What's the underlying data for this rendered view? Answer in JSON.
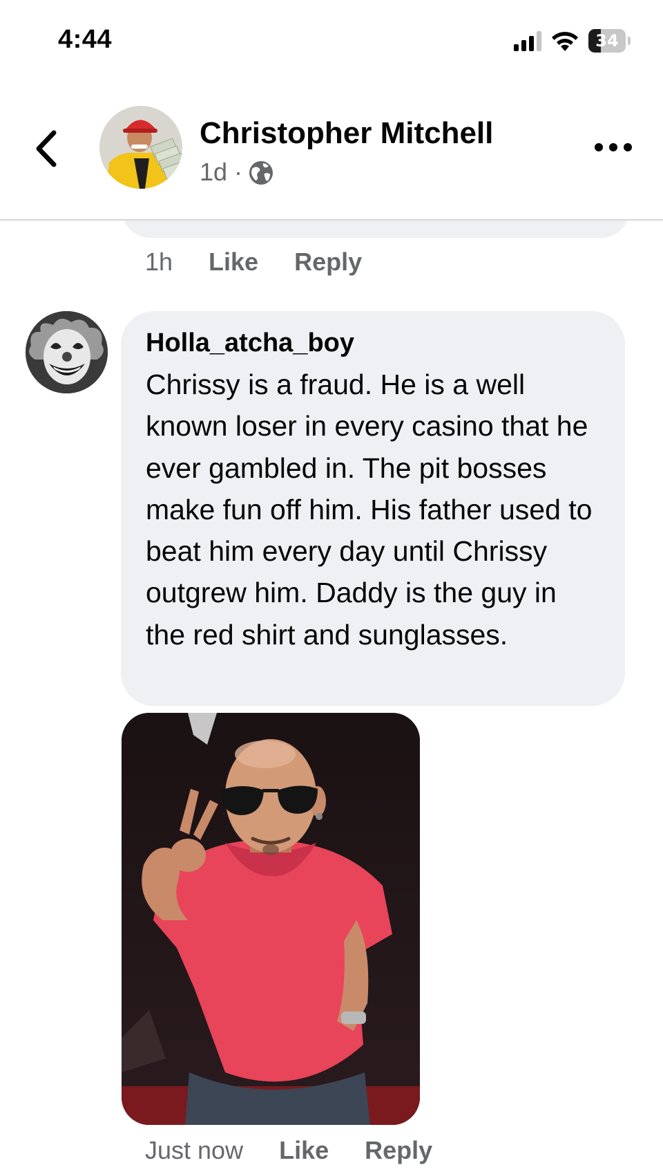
{
  "status_bar": {
    "time": "4:44",
    "battery": "34",
    "battery_level": 0.34
  },
  "header": {
    "name": "Christopher Mitchell",
    "age": "1d",
    "dot": "·",
    "audience_icon": "globe-icon",
    "back_icon": "chevron-left-icon",
    "more_icon": "more-horizontal-icon"
  },
  "previous_comment": {
    "time": "1h",
    "like_label": "Like",
    "reply_label": "Reply"
  },
  "comment": {
    "author": "Holla_atcha_boy",
    "text": "Chrissy is a fraud. He is a well known loser in every casino that he ever gambled in. The pit bosses make fun off him. His father used to beat him every day until Chrissy outgrew him. Daddy is the guy in the red shirt and sunglasses.",
    "time": "Just now",
    "like_label": "Like",
    "reply_label": "Reply"
  },
  "colors": {
    "bubble": "#eff0f3",
    "secondary_text": "#65676b",
    "primary_text": "#050505"
  }
}
